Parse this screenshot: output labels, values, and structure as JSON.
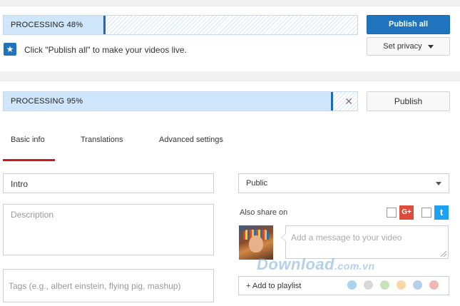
{
  "batch": {
    "progress_label": "PROCESSING 48%",
    "progress_value": 0.48,
    "publish_all_label": "Publish all",
    "set_privacy_label": "Set privacy",
    "hint_text": "Click \"Publish all\" to make your videos live."
  },
  "video": {
    "progress_label": "PROCESSING 95%",
    "progress_value": 0.95,
    "publish_label": "Publish"
  },
  "tabs": [
    {
      "label": "Basic info",
      "active": true
    },
    {
      "label": "Translations",
      "active": false
    },
    {
      "label": "Advanced settings",
      "active": false
    }
  ],
  "form": {
    "title_value": "Intro",
    "description_placeholder": "Description",
    "tags_placeholder": "Tags (e.g., albert einstein, flying pig, mashup)",
    "privacy_value": "Public",
    "also_share_label": "Also share on",
    "share_gplus_label": "G+",
    "share_twitter_label": "t",
    "message_placeholder": "Add a message to your video",
    "add_to_playlist_label": "+ Add to playlist"
  },
  "playlist_colors": [
    "#a9d3ef",
    "#d9d9d9",
    "#c7e4b8",
    "#f7d7a8",
    "#b8cfe8",
    "#f2b6b9"
  ],
  "watermark": {
    "main": "Download",
    "suffix": ".com.vn"
  },
  "colors": {
    "accent_blue": "#1f74bd",
    "active_tab_red": "#cc181e",
    "progress_fill": "#cfe5f9"
  }
}
